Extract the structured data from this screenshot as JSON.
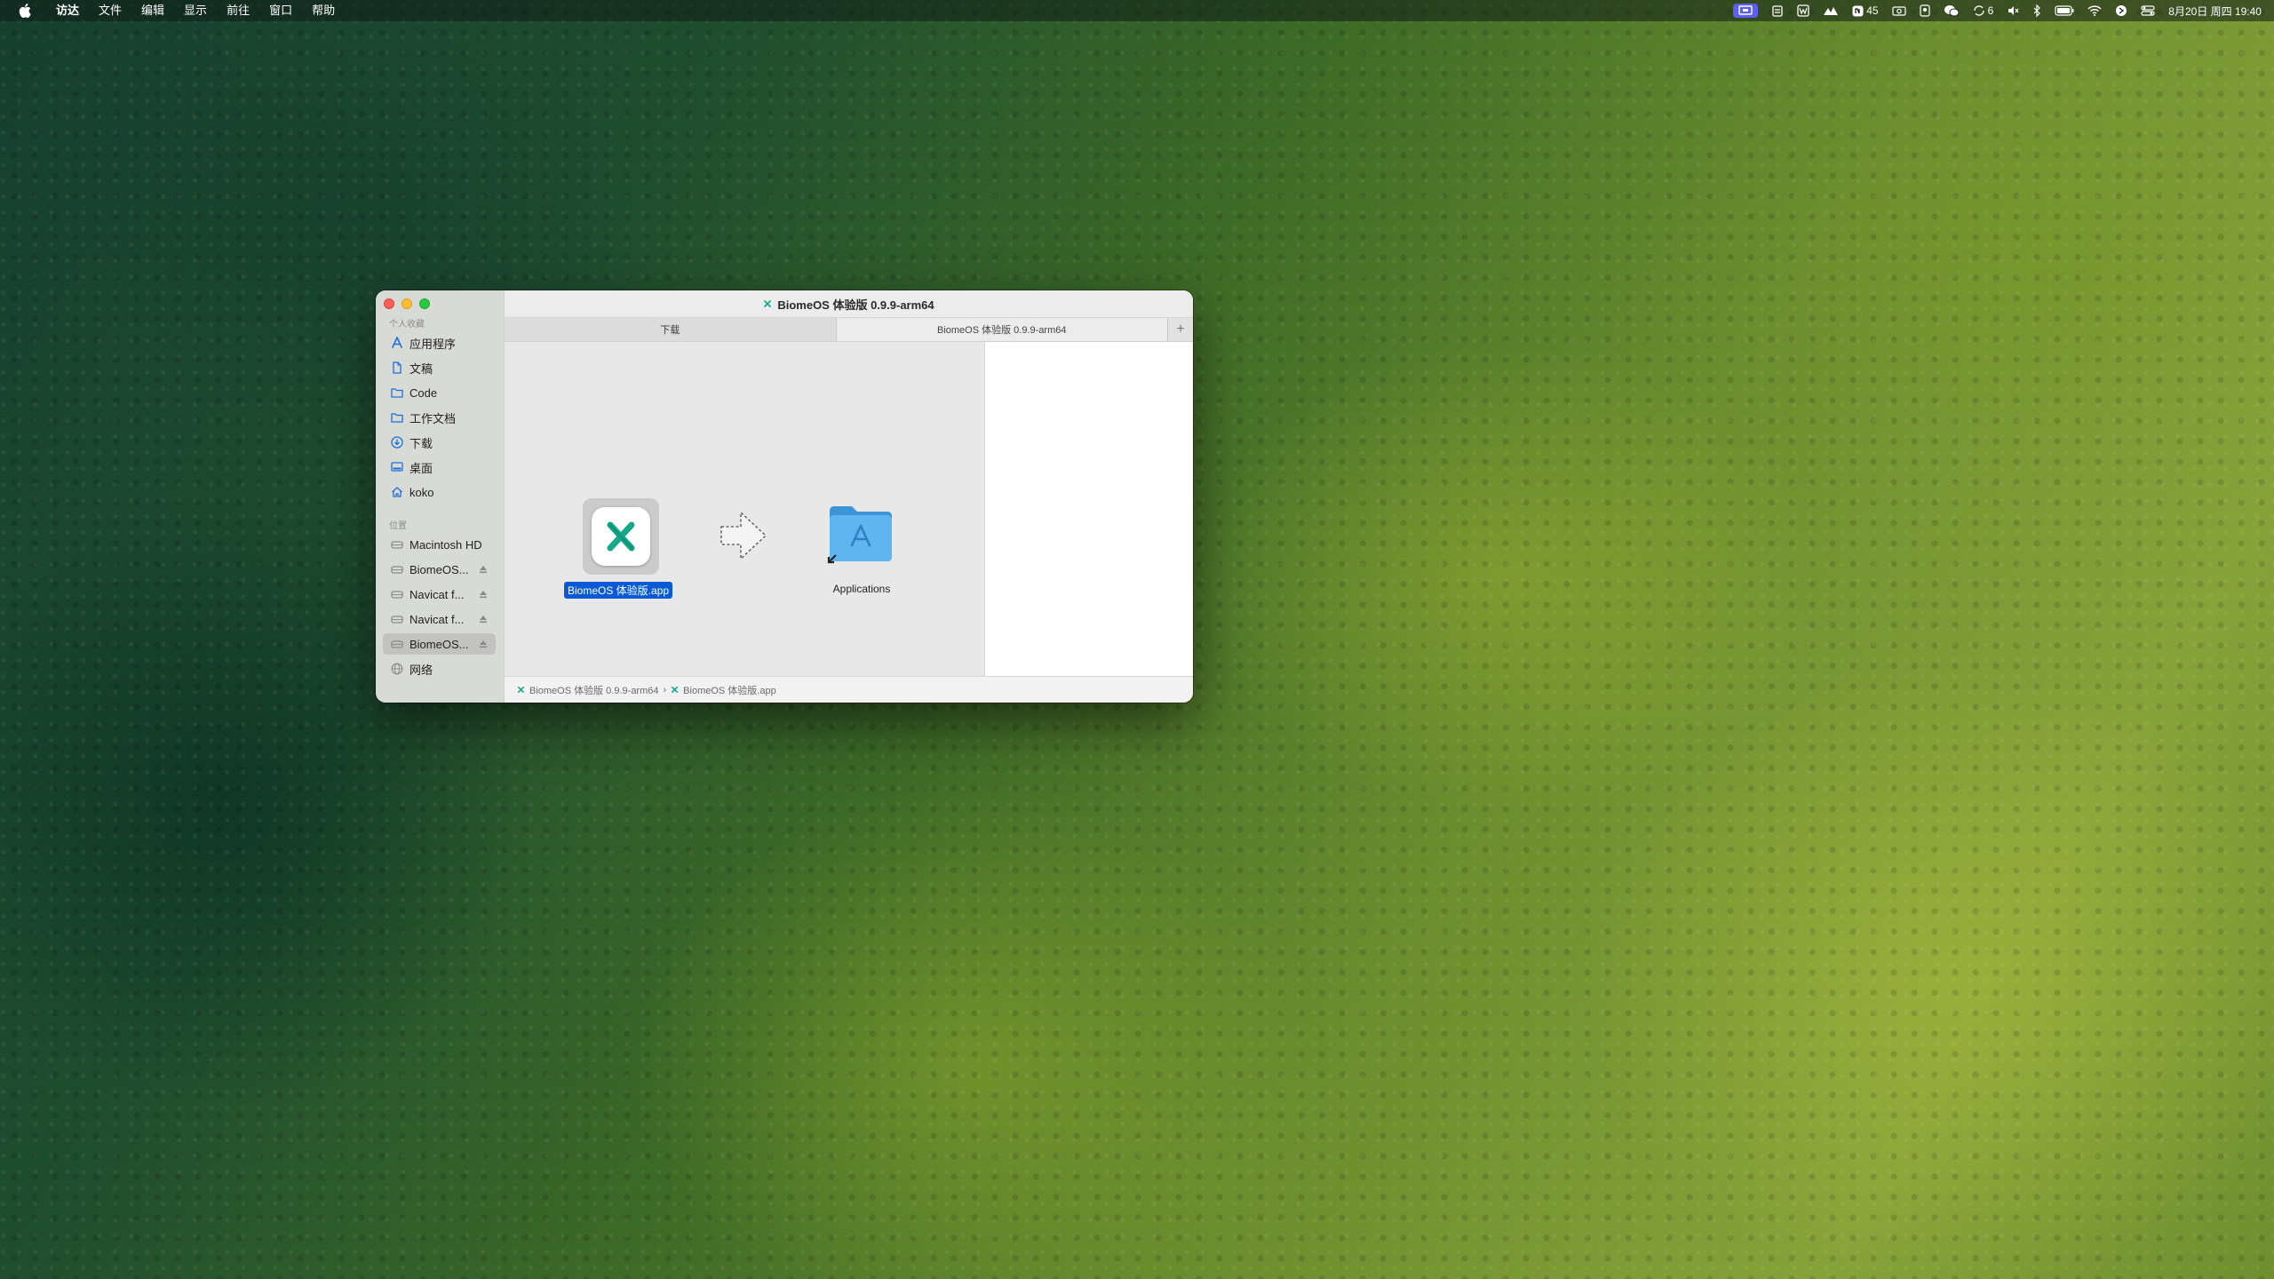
{
  "menubar": {
    "items": [
      "访达",
      "文件",
      "编辑",
      "显示",
      "前往",
      "窗口",
      "帮助"
    ],
    "status": {
      "badge_count_1": "45",
      "badge_count_2": "6",
      "clock": "8月20日 周四 19:40"
    }
  },
  "window": {
    "title": "BiomeOS 体验版 0.9.9-arm64",
    "tabs": [
      "下载",
      "BiomeOS 体验版 0.9.9-arm64"
    ],
    "tab_add": "+",
    "sidebar": {
      "favorites_header": "个人收藏",
      "favorites": [
        "应用程序",
        "文稿",
        "Code",
        "工作文档",
        "下载",
        "桌面",
        "koko"
      ],
      "locations_header": "位置",
      "locations": [
        "Macintosh HD",
        "BiomeOS...",
        "Navicat f...",
        "Navicat f...",
        "BiomeOS...",
        "网络"
      ]
    },
    "items": {
      "app_label": "BiomeOS 体验版.app",
      "folder_label": "Applications"
    },
    "pathbar": [
      "BiomeOS 体验版 0.9.9-arm64",
      "BiomeOS 体验版.app"
    ],
    "path_separator": "›"
  },
  "colors": {
    "selection": "#0a5ad6",
    "folder": "#49a7e8",
    "app_accent": "#14a98a"
  }
}
